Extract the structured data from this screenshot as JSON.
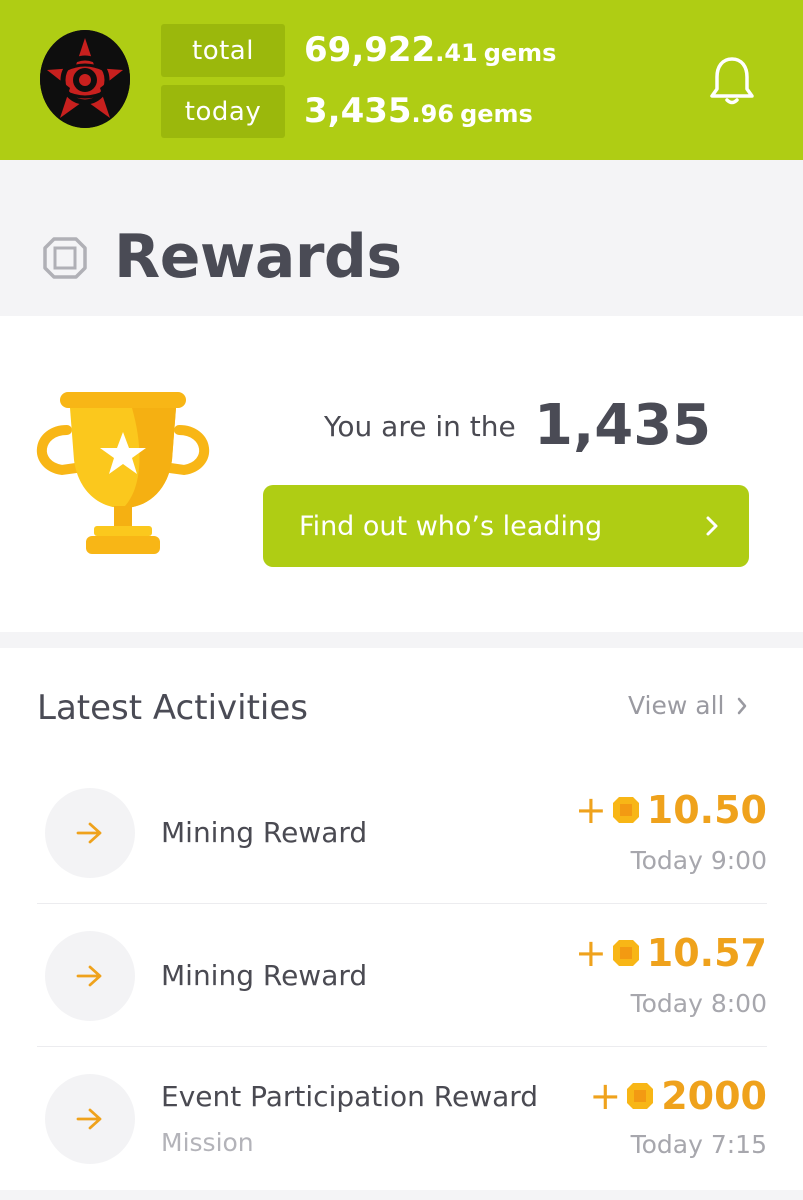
{
  "header": {
    "total_label": "total",
    "total_value_int": "69,922",
    "total_value_dec": ".41",
    "total_unit": "gems",
    "today_label": "today",
    "today_value_int": "3,435",
    "today_value_dec": ".96",
    "today_unit": "gems",
    "icons": {
      "avatar": "avatar",
      "notification": "bell-icon"
    }
  },
  "rewards": {
    "title": "Rewards",
    "rank_prefix": "You are in the",
    "rank_value": "1,435",
    "leader_button": "Find out who’s leading"
  },
  "activities": {
    "title": "Latest Activities",
    "view_all": "View all",
    "items": [
      {
        "name": "Mining Reward",
        "sub": "",
        "plus": "+",
        "amount": "10.50",
        "time": "Today 9:00"
      },
      {
        "name": "Mining Reward",
        "sub": "",
        "plus": "+",
        "amount": "10.57",
        "time": "Today 8:00"
      },
      {
        "name": "Event Participation Reward",
        "sub": "Mission",
        "plus": "+",
        "amount": "2000",
        "time": "Today 7:15"
      }
    ]
  },
  "colors": {
    "brand": "#afcd14",
    "brand_dark": "#9bb80c",
    "accent": "#efa21c",
    "text": "#4a4b55"
  }
}
